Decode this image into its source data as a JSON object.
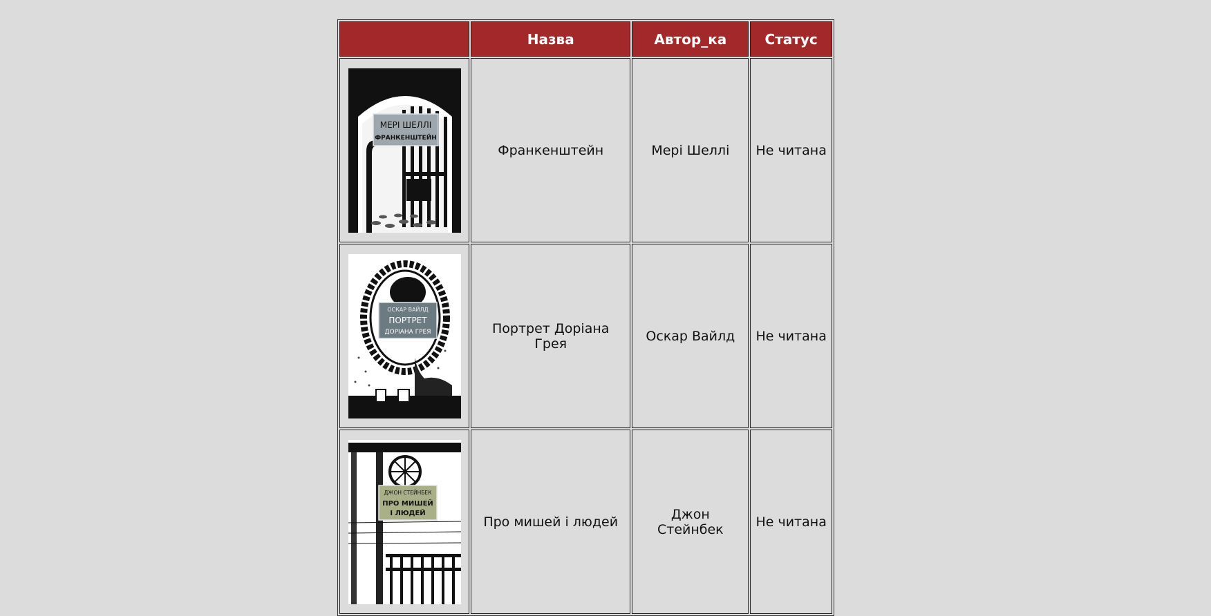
{
  "table": {
    "headers": [
      "",
      "Назва",
      "Автор_ка",
      "Статус"
    ],
    "rows": [
      {
        "title": "Франкенштейн",
        "author": "Мері Шеллі",
        "status": "Не читана",
        "cover_text": [
          "МЕРІ ШЕЛЛІ",
          "ФРАНКЕНШТЕЙН"
        ],
        "cover_icon": "gate-illustration"
      },
      {
        "title": "Портрет Доріана Грея",
        "author": "Оскар Вайлд",
        "status": "Не читана",
        "cover_text": [
          "ОСКАР ВАЙЛД",
          "ПОРТРЕТ",
          "ДОРІАНА ГРЕЯ"
        ],
        "cover_icon": "mirror-illustration"
      },
      {
        "title": "Про мишей і людей",
        "author": "Джон Стейнбек",
        "status": "Не читана",
        "cover_text": [
          "ДЖОН СТЕЙНБЕК",
          "ПРО МИШЕЙ",
          "І ЛЮДЕЙ"
        ],
        "cover_icon": "ranch-gate-illustration"
      }
    ]
  },
  "colors": {
    "header_bg": "#a3282a",
    "page_bg": "#dcdcdc"
  }
}
